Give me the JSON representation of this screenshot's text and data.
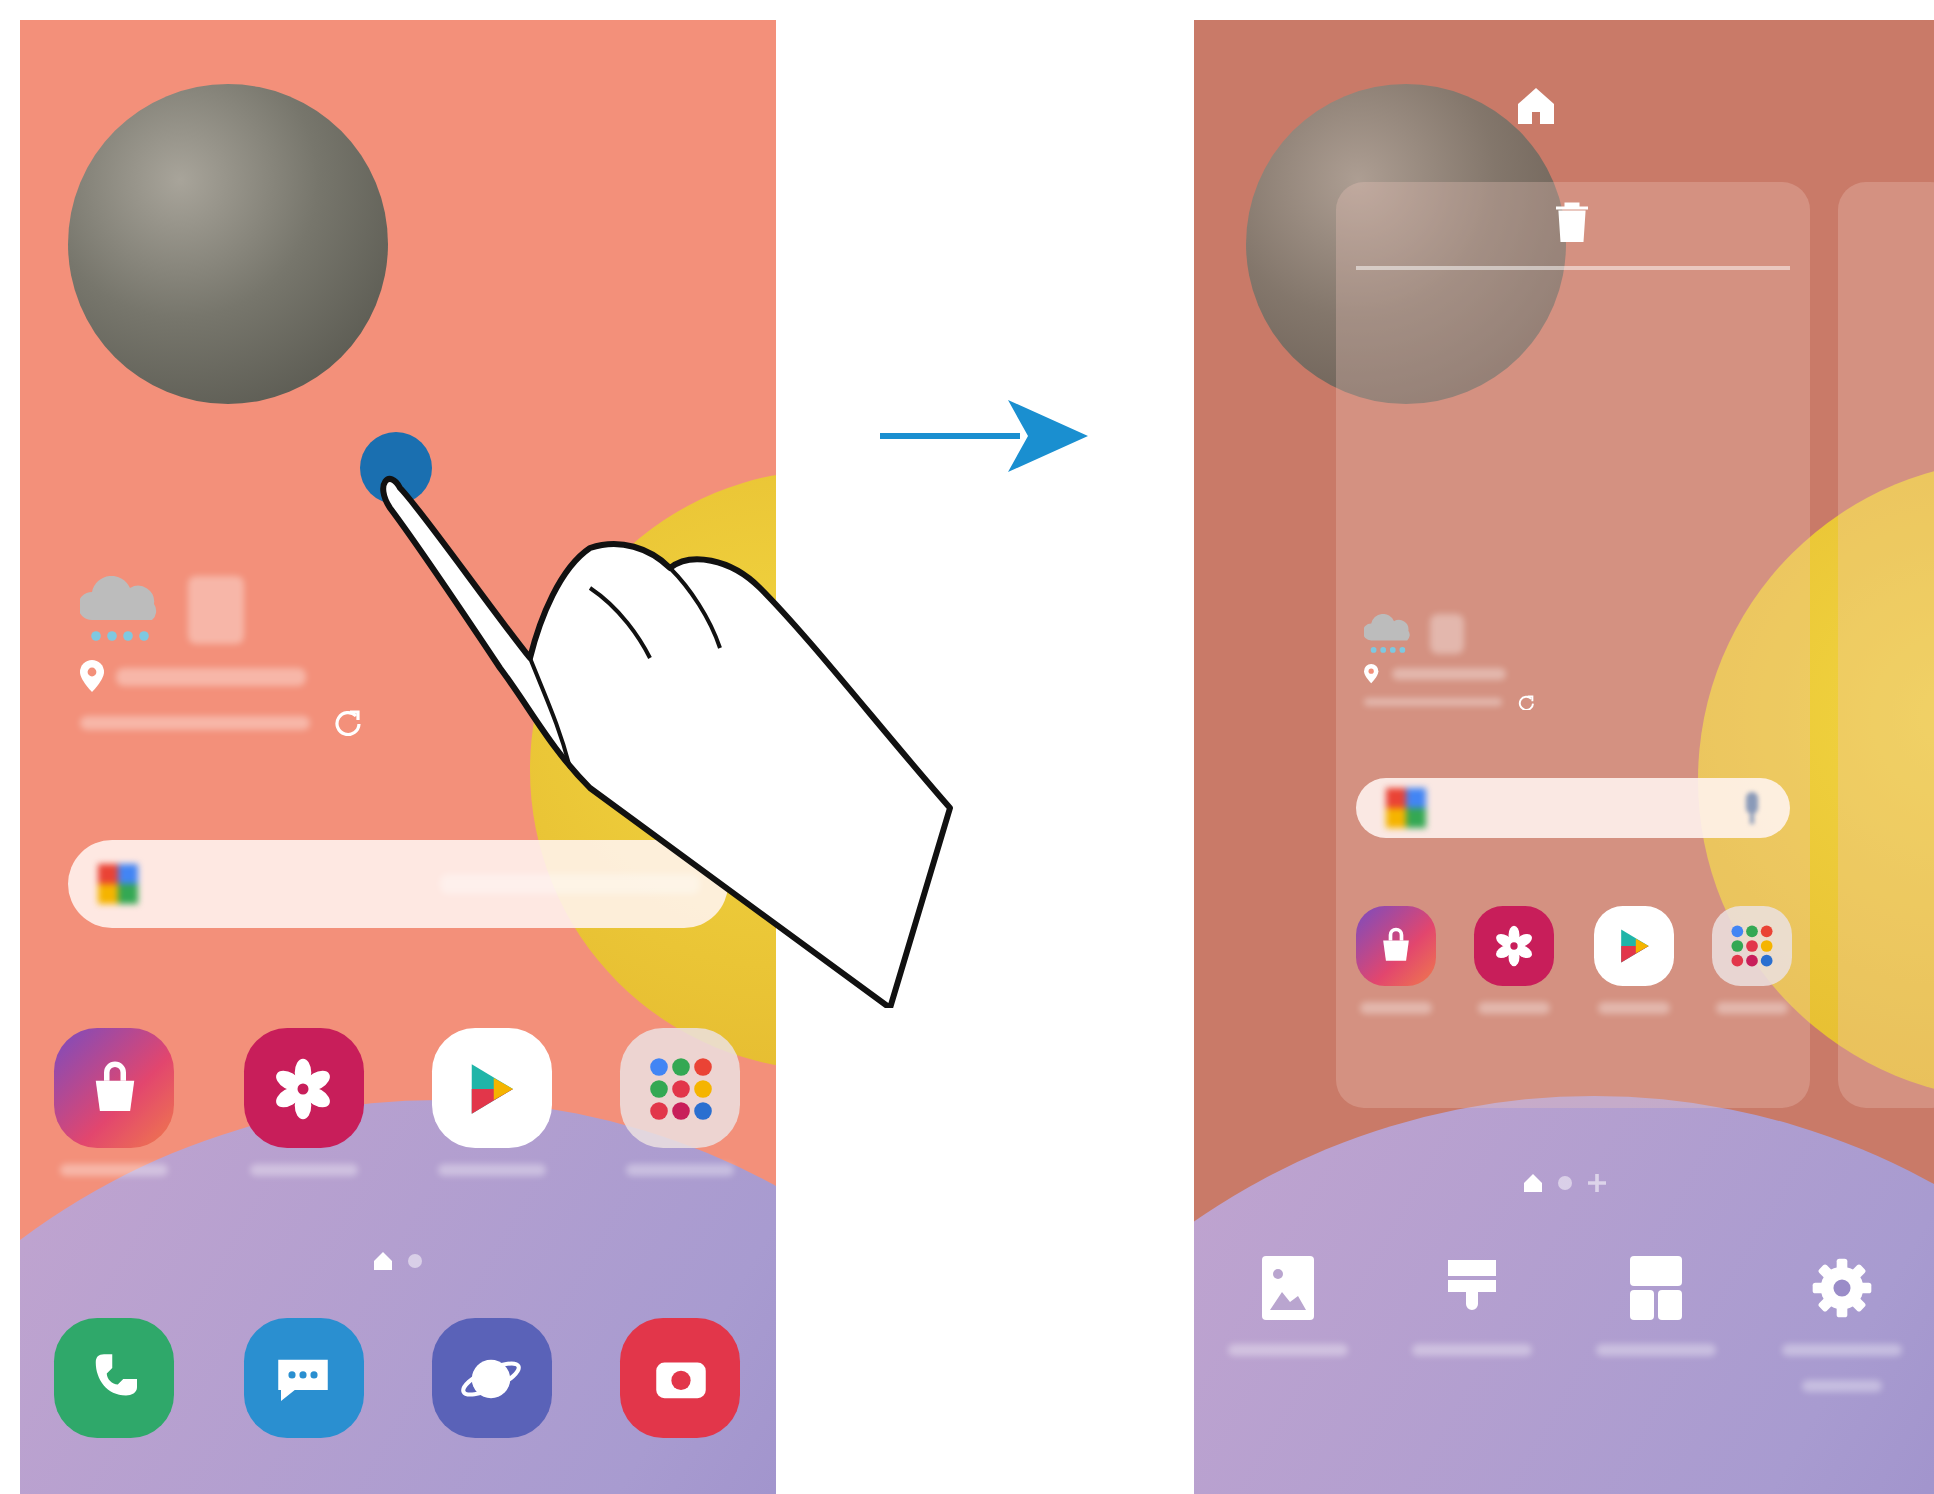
{
  "home_screen": {
    "apps": [
      {
        "kind": "store"
      },
      {
        "kind": "gallery"
      },
      {
        "kind": "play"
      },
      {
        "kind": "folder"
      }
    ],
    "page_dots": [
      {
        "kind": "home",
        "selected": true
      },
      {
        "kind": "dot",
        "selected": false
      }
    ],
    "dock": [
      {
        "kind": "phone"
      },
      {
        "kind": "messages"
      },
      {
        "kind": "internet"
      },
      {
        "kind": "camera"
      }
    ]
  },
  "edit_screen": {
    "page_dots": [
      {
        "kind": "home",
        "selected": true
      },
      {
        "kind": "dot",
        "selected": false
      },
      {
        "kind": "add",
        "selected": false
      }
    ],
    "options": [
      {
        "kind": "wallpaper"
      },
      {
        "kind": "themes"
      },
      {
        "kind": "widgets"
      },
      {
        "kind": "settings"
      }
    ]
  }
}
